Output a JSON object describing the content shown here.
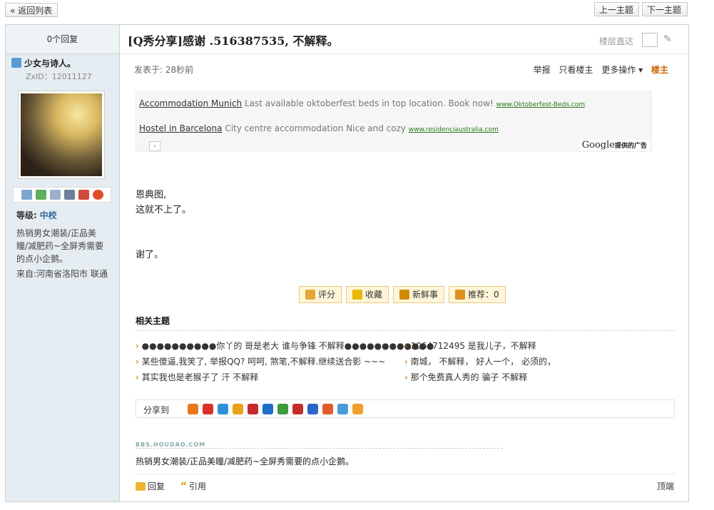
{
  "nav": {
    "back": "« 返回列表",
    "prev": "上一主题",
    "next": "下一主题"
  },
  "thread": {
    "reply_count": "0个回复",
    "title": "[Q秀分享]感谢 .516387535, 不解释。",
    "jump_label": "楼层直达"
  },
  "author": {
    "name": "少女与诗人。",
    "zxid": "ZxID：12011127",
    "level_label": "等级:",
    "level": "中校",
    "bio": "热销男女潮装/正品美瞳/减肥药~全屏秀需要的点小企鹅。",
    "from": "来自:河南省洛阳市 联通",
    "icons": [
      "mail-icon",
      "add-friend-icon",
      "profile-icon",
      "card-icon",
      "blocks-icon",
      "qq-penguin-icon"
    ]
  },
  "post": {
    "time": "发表于: 28秒前",
    "report": "举报",
    "only_op": "只看楼主",
    "more": "更多操作 ▾",
    "floor": "楼主",
    "content": [
      "恩典图,",
      "这就不上了。",
      "",
      "",
      "谢了。"
    ]
  },
  "ads": [
    {
      "title": "Accommodation Munich",
      "text": "Last available oktoberfest beds in top location. Book now!",
      "url": "www.Oktoberfest-Beds.com"
    },
    {
      "title": "Hostel in Barcelona",
      "text": "City centre accommodation Nice and cozy",
      "url": "www.residenciaustralia.com"
    }
  ],
  "google": {
    "name": "Google",
    "suffix": "提供的广告"
  },
  "rate_buttons": [
    {
      "label": "评分",
      "color": "#e6a53a"
    },
    {
      "label": "收藏",
      "color": "#e6b800"
    },
    {
      "label": "新鲜事",
      "color": "#d08a00"
    },
    {
      "label": "推荐：0",
      "color": "#e09020"
    }
  ],
  "related": {
    "title": "相关主题",
    "items": [
      "●●●●●●●●●●你丫的 哥是老大 谁与争锋  不解释●●●●●●●●●●●●",
      "1064712495    是我儿子，不解释",
      "某些傻逼,我笑了, 举报QQ?  呵呵,   煞笔,不解释.继续送合影 ~~~",
      "南城，  不解释，   好人一个，  必须的，",
      "其实我也是老猴子了      汗 不解释",
      "那个免费真人秀的  骗子 不解释"
    ]
  },
  "share": {
    "label": "分享到",
    "colors": [
      "#e8761c",
      "#d7332b",
      "#2f8fd8",
      "#e9a21a",
      "#c72a2a",
      "#1f6ec7",
      "#3c9a3c",
      "#c52d2d",
      "#2a64c9",
      "#e45a2a",
      "#4a9ad8",
      "#f0a030"
    ]
  },
  "signature": {
    "logo": "BBS.HOUDAO.COM",
    "text": "热销男女潮装/正品美瞳/减肥药~全屏秀需要的点小企鹅。"
  },
  "footer": {
    "reply": "回复",
    "quote": "引用",
    "top": "顶端"
  }
}
